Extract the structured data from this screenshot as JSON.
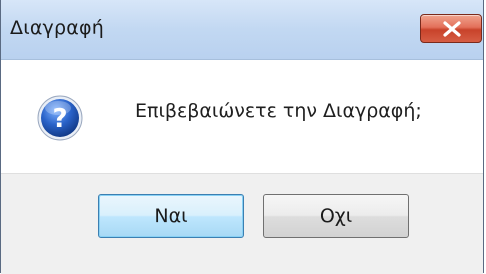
{
  "dialog": {
    "title": "Διαγραφή",
    "message": "Επιβεβαιώνετε την Διαγραφή;",
    "icon": "question-icon",
    "buttons": {
      "yes_label": "Ναι",
      "no_label": "Οχι"
    }
  },
  "colors": {
    "titlebar": "#c2d8f2",
    "close_button": "#d65d44",
    "footer": "#f0f0f0",
    "default_button_border": "#3c7fb1",
    "icon_blue": "#1f56b8"
  }
}
